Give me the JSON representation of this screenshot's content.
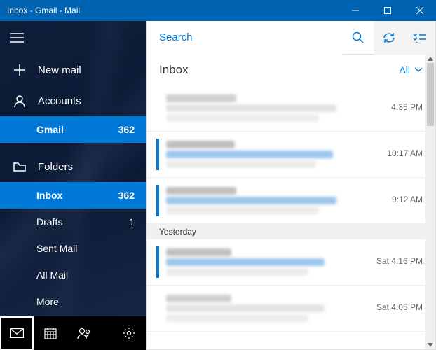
{
  "window": {
    "title": "Inbox - Gmail - Mail"
  },
  "sidebar": {
    "new_mail": "New mail",
    "accounts": "Accounts",
    "account_items": [
      {
        "label": "Gmail",
        "count": "362",
        "selected": true
      }
    ],
    "folders_label": "Folders",
    "folders": [
      {
        "label": "Inbox",
        "count": "362",
        "selected": true,
        "bold": true
      },
      {
        "label": "Drafts",
        "count": "1",
        "selected": false,
        "bold": false
      },
      {
        "label": "Sent Mail",
        "count": "",
        "selected": false,
        "bold": false
      },
      {
        "label": "All Mail",
        "count": "",
        "selected": false,
        "bold": false
      },
      {
        "label": "More",
        "count": "",
        "selected": false,
        "bold": false
      }
    ]
  },
  "search": {
    "placeholder": "Search"
  },
  "list_header": {
    "title": "Inbox",
    "filter": "All"
  },
  "groups": [
    {
      "label": "",
      "messages": [
        {
          "time": "4:35 PM",
          "unread": false
        },
        {
          "time": "10:17 AM",
          "unread": true
        },
        {
          "time": "9:12 AM",
          "unread": true
        }
      ]
    },
    {
      "label": "Yesterday",
      "messages": [
        {
          "time": "Sat 4:16 PM",
          "unread": true
        },
        {
          "time": "Sat 4:05 PM",
          "unread": false
        }
      ]
    }
  ]
}
